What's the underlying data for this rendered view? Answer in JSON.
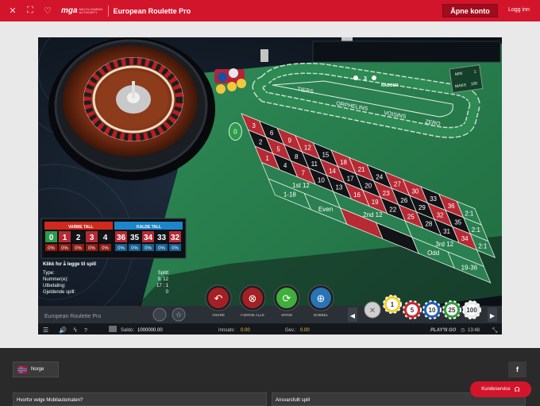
{
  "header": {
    "close_icon": "close-icon",
    "fullscreen_icon": "fullscreen-icon",
    "favorite_icon": "heart-icon",
    "logo_text": "mga",
    "logo_sub": "MALTA GAMING AUTHORITY",
    "title": "European Roulette Pro",
    "open_account": "Åpne konto",
    "login": "Logg inn",
    "brand_color": "#d3152c"
  },
  "game": {
    "hot_numbers": {
      "title": "VARME TALL",
      "values": [
        "0",
        "1",
        "2",
        "3",
        "4"
      ],
      "percents": [
        "0%",
        "0%",
        "0%",
        "0%",
        "0%"
      ]
    },
    "cold_numbers": {
      "title": "KALDE TALL",
      "values": [
        "36",
        "35",
        "34",
        "33",
        "32"
      ],
      "percents": [
        "0%",
        "0%",
        "0%",
        "0%",
        "0%"
      ]
    },
    "bet_info": {
      "heading": "Klikk for å legge til spill",
      "rows": [
        {
          "label": "Type:",
          "value": "Splitt"
        },
        {
          "label": "Nummer(e):",
          "value": "9, 12"
        },
        {
          "label": "Utbetaling:",
          "value": "17 : 1"
        },
        {
          "label": "Gjeldende spill:",
          "value": "0"
        }
      ]
    },
    "neighbours": {
      "count": "3",
      "label": "NABOER"
    },
    "racetrack": [
      "TIERS",
      "ORPHELINS",
      "VOISINS",
      "ZERO"
    ],
    "limits": {
      "min_label": "MIN",
      "min_value": "1",
      "maks_label": "MAKS",
      "maks_value": "100"
    },
    "table": {
      "zero": "0",
      "numbers": [
        [
          "3",
          "6",
          "9",
          "12",
          "15",
          "18",
          "21",
          "24",
          "27",
          "30",
          "33",
          "36"
        ],
        [
          "2",
          "5",
          "8",
          "11",
          "14",
          "17",
          "20",
          "23",
          "26",
          "29",
          "32",
          "35"
        ],
        [
          "1",
          "4",
          "7",
          "10",
          "13",
          "16",
          "19",
          "22",
          "25",
          "28",
          "31",
          "34"
        ]
      ],
      "reds": [
        "1",
        "3",
        "5",
        "7",
        "9",
        "12",
        "14",
        "16",
        "18",
        "19",
        "21",
        "23",
        "25",
        "27",
        "30",
        "32",
        "34",
        "36"
      ],
      "columns": [
        "2:1",
        "2:1",
        "2:1"
      ],
      "dozens": [
        "1st 12",
        "2nd 12",
        "3rd 12"
      ],
      "outside": [
        "1-18",
        "Even",
        "",
        "",
        "Odd",
        "19-36"
      ]
    },
    "game_name": "European Roulette Pro",
    "actions": [
      {
        "label": "ANGRE",
        "icon": "undo-icon"
      },
      {
        "label": "FJERNE ALLE",
        "icon": "clear-all-icon"
      },
      {
        "label": "SPINN",
        "icon": "spin-icon"
      },
      {
        "label": "DOBBEL",
        "icon": "double-icon"
      }
    ],
    "chips": [
      "1",
      "5",
      "10",
      "25",
      "100"
    ],
    "bottom": {
      "balance_label": "Saldo:",
      "balance_value": "1000000.00",
      "bet_label": "Innsats:",
      "bet_value": "0.00",
      "win_label": "Gev.:",
      "win_value": "0.00",
      "provider": "PLAY'N GO",
      "time": "13:48"
    }
  },
  "footer": {
    "language": "Norge",
    "facebook": "f",
    "accordion_1": "Hvorfor velge Mobilautomaten?",
    "accordion_2": "Ansvarsfullt spill",
    "support": "Kundeservice"
  }
}
